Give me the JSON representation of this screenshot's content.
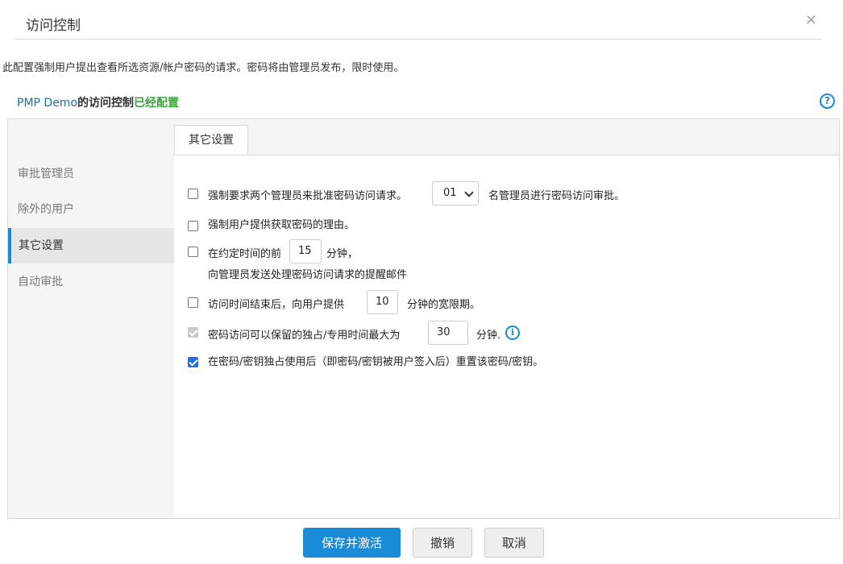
{
  "dialog": {
    "title": "访问控制",
    "close_label": "×",
    "description": "此配置强制用户提出查看所选资源/帐户密码的请求。密码将由管理员发布，限时使用。"
  },
  "status": {
    "resource": "PMP Demo",
    "middle": "的访问控制",
    "state": "已经配置",
    "help_label": "?"
  },
  "sidebar": {
    "items": [
      {
        "label": "审批管理员",
        "active": false
      },
      {
        "label": "除外的用户",
        "active": false
      },
      {
        "label": "其它设置",
        "active": true
      },
      {
        "label": "自动审批",
        "active": false
      }
    ]
  },
  "tab": {
    "label": "其它设置"
  },
  "settings": {
    "two_admins": {
      "checked": false,
      "text_before": "强制要求两个管理员来批准密码访问请求。",
      "select_value": "01",
      "text_after": "名管理员进行密码访问审批。"
    },
    "reason": {
      "checked": false,
      "text": "强制用户提供获取密码的理由。"
    },
    "reminder": {
      "checked": false,
      "text_before": "在约定时间的前",
      "value": "15",
      "text_after": "分钟，",
      "line2": "向管理员发送处理密码访问请求的提醒邮件"
    },
    "grace": {
      "checked": false,
      "text_before": "访问时间结束后，向用户提供",
      "value": "10",
      "text_after": "分钟的宽限期。"
    },
    "exclusive": {
      "checked": true,
      "disabled": true,
      "text_before": "密码访问可以保留的独占/专用时间最大为",
      "value": "30",
      "text_after": "分钟.",
      "info_label": "i"
    },
    "reset": {
      "checked": true,
      "text": "在密码/密钥独占使用后（即密码/密钥被用户签入后）重置该密码/密钥。"
    }
  },
  "buttons": {
    "save_activate": "保存并激活",
    "revoke": "撤销",
    "cancel": "取消"
  },
  "colors": {
    "accent": "#1a8bd6",
    "configured": "#3aa63a",
    "resource": "#1f6fa5"
  }
}
